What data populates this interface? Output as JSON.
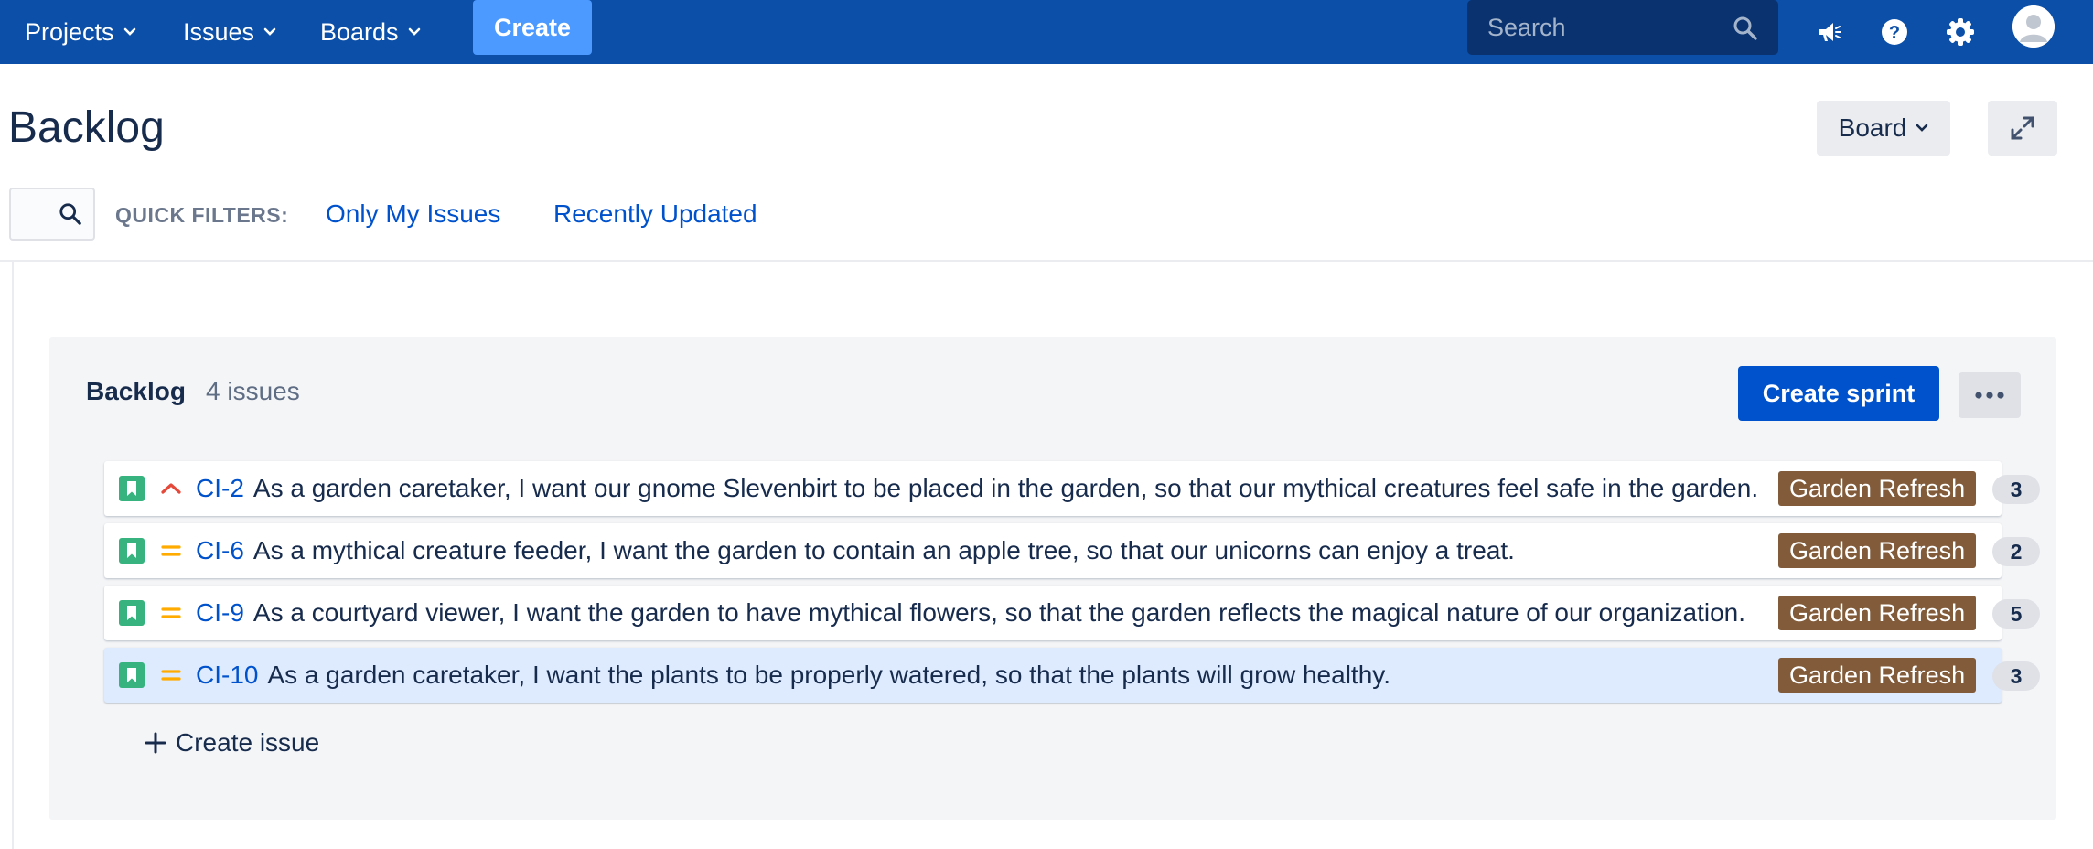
{
  "nav": {
    "projects": "Projects",
    "issues": "Issues",
    "boards": "Boards",
    "create": "Create",
    "search_placeholder": "Search",
    "icons": [
      "megaphone-icon",
      "help-icon",
      "gear-icon",
      "avatar"
    ]
  },
  "header": {
    "title": "Backlog",
    "board_button": "Board"
  },
  "filters": {
    "label": "QUICK FILTERS:",
    "only_my_issues": "Only My Issues",
    "recently_updated": "Recently Updated"
  },
  "backlog": {
    "title": "Backlog",
    "count": "4 issues",
    "create_sprint": "Create sprint",
    "create_issue": "Create issue",
    "issues": [
      {
        "key": "CI-2",
        "summary": "As a garden caretaker, I want our gnome Slevenbirt to be placed in the garden, so that our mythical creatures feel safe in the garden.",
        "epic": "Garden Refresh",
        "points": "3",
        "priority": "high",
        "selected": false
      },
      {
        "key": "CI-6",
        "summary": "As a mythical creature feeder, I want the garden to contain an apple tree, so that our unicorns can enjoy a treat.",
        "epic": "Garden Refresh",
        "points": "2",
        "priority": "medium",
        "selected": false
      },
      {
        "key": "CI-9",
        "summary": "As a courtyard viewer, I want the garden to have mythical flowers, so that the garden reflects the magical nature of our organization.",
        "epic": "Garden Refresh",
        "points": "5",
        "priority": "medium",
        "selected": false
      },
      {
        "key": "CI-10",
        "summary": "As a garden caretaker, I want the plants to be properly watered, so that the plants will grow healthy.",
        "epic": "Garden Refresh",
        "points": "3",
        "priority": "medium",
        "selected": true
      }
    ]
  },
  "colors": {
    "nav_bg": "#0b4fa8",
    "primary": "#0052cc",
    "story_green": "#36b37e",
    "priority_high": "#e5493a",
    "priority_medium": "#ffab00",
    "epic_brown": "#815b3a",
    "selected_row": "#deebff"
  }
}
